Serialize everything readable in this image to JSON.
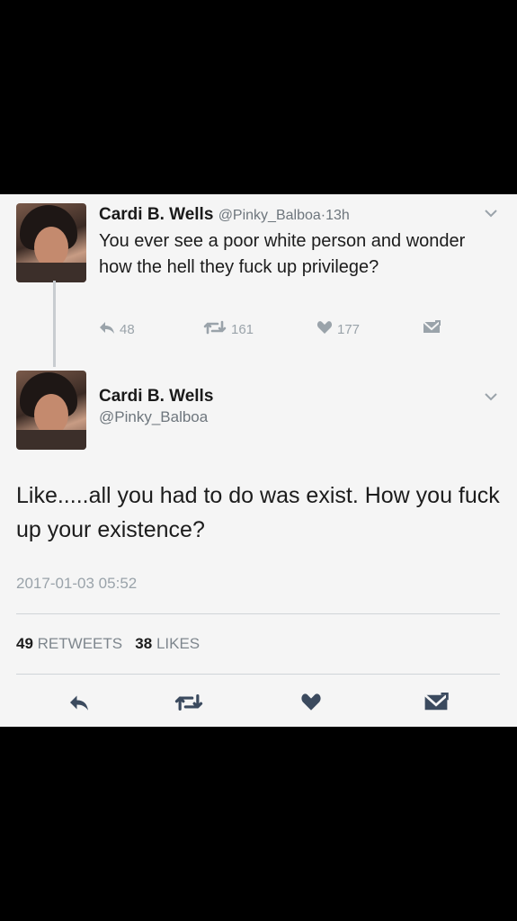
{
  "reply_tweet": {
    "author_name": "Cardi B. Wells",
    "handle": "@Pinky_Balboa",
    "separator": "·",
    "time_ago": "13h",
    "text": "You ever see a poor white person and wonder how the hell they fuck up privilege?",
    "reply_count": "48",
    "retweet_count": "161",
    "like_count": "177"
  },
  "main_tweet": {
    "author_name": "Cardi B. Wells",
    "handle": "@Pinky_Balboa",
    "text": "Like.....all you had to do was exist. How you fuck up your existence?",
    "timestamp": "2017-01-03 05:52",
    "retweets_count": "49",
    "retweets_label": "RETWEETS",
    "likes_count": "38",
    "likes_label": "LIKES"
  },
  "icons": {
    "reply": "reply-arrow-icon",
    "retweet": "retweet-icon",
    "like": "heart-icon",
    "dm": "envelope-icon",
    "menu": "chevron-down-icon"
  },
  "colors": {
    "icon_gray": "#9aa3aa",
    "action_dark": "#3b4a5e",
    "text": "#1c1c1c"
  }
}
